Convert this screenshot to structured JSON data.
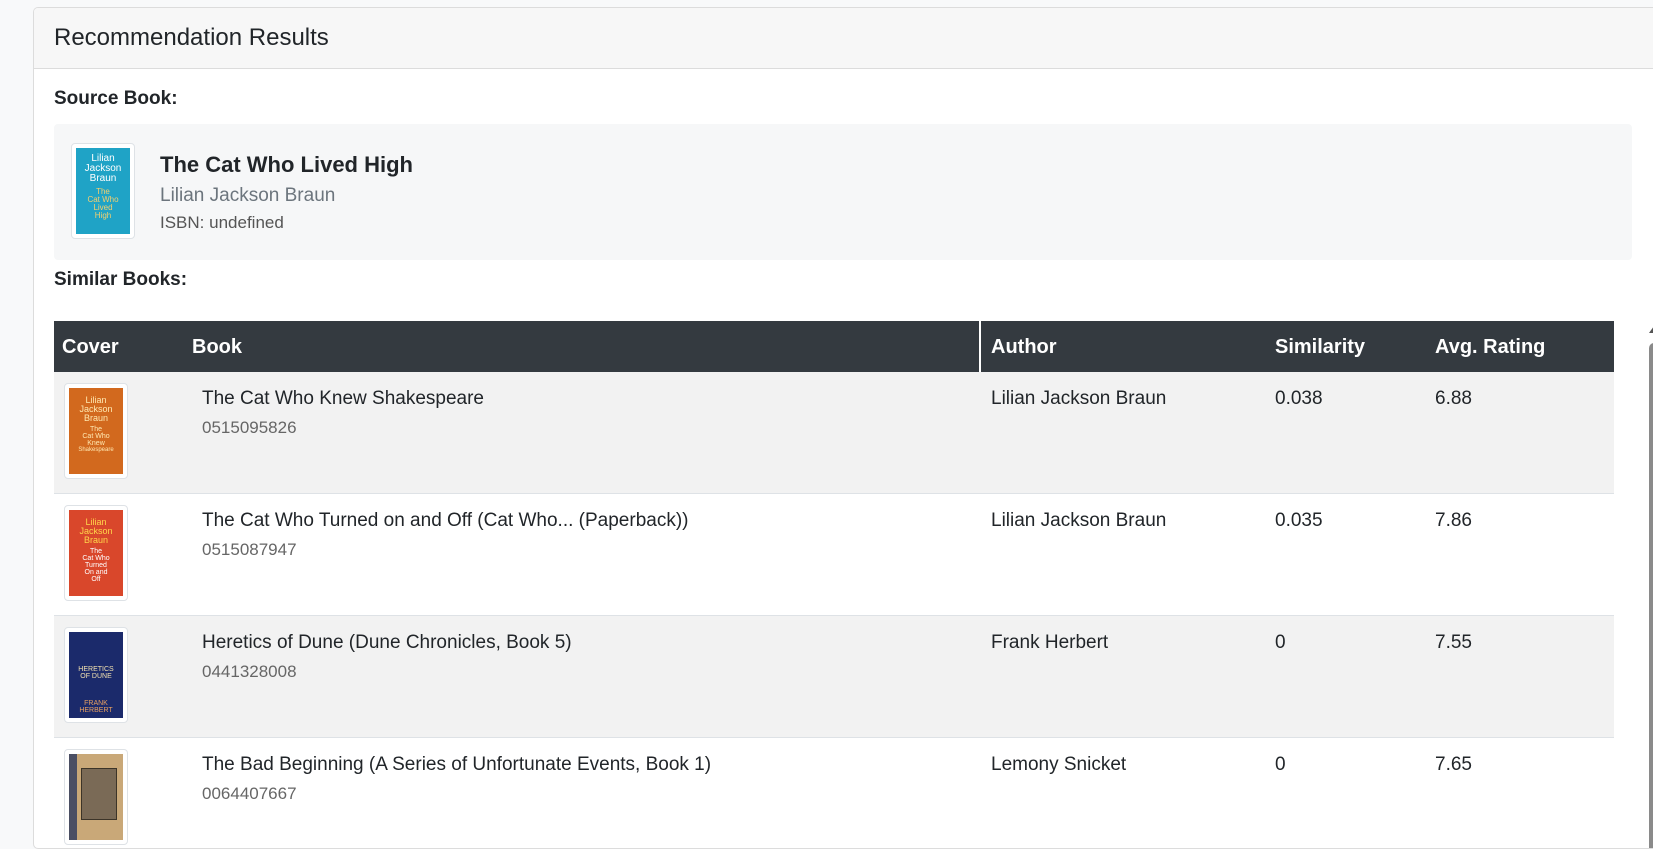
{
  "header": {
    "title": "Recommendation Results"
  },
  "source": {
    "label": "Source Book:",
    "title": "The Cat Who Lived High",
    "author": "Lilian Jackson Braun",
    "isbn": "ISBN: undefined",
    "cover_lines": [
      "Lilian",
      "Jackson",
      "Braun",
      "The",
      "Cat Who",
      "Lived",
      "High"
    ]
  },
  "similar": {
    "label": "Similar Books:",
    "columns": {
      "cover": "Cover",
      "book": "Book",
      "author": "Author",
      "similarity": "Similarity",
      "rating": "Avg. Rating"
    },
    "rows": [
      {
        "title": "The Cat Who Knew Shakespeare",
        "isbn": "0515095826",
        "author": "Lilian Jackson Braun",
        "similarity": "0.038",
        "rating": "6.88",
        "cover_lines": [
          "Lilian",
          "Jackson",
          "Braun",
          "The",
          "Cat Who",
          "Knew",
          "Shakespeare"
        ],
        "cover_color": "#d2691e"
      },
      {
        "title": "The Cat Who Turned on and Off (Cat Who... (Paperback))",
        "isbn": "0515087947",
        "author": "Lilian Jackson Braun",
        "similarity": "0.035",
        "rating": "7.86",
        "cover_lines": [
          "Lilian",
          "Jackson",
          "Braun",
          "The",
          "Cat Who",
          "Turned",
          "On and",
          "Off"
        ],
        "cover_color": "#d9472b"
      },
      {
        "title": "Heretics of Dune (Dune Chronicles, Book 5)",
        "isbn": "0441328008",
        "author": "Frank Herbert",
        "similarity": "0",
        "rating": "7.55",
        "cover_lines": [
          "HERETICS",
          "OF DUNE",
          "FRANK",
          "HERBERT"
        ],
        "cover_color": "#1b2a6b"
      },
      {
        "title": "The Bad Beginning (A Series of Unfortunate Events, Book 1)",
        "isbn": "0064407667",
        "author": "Lemony Snicket",
        "similarity": "0",
        "rating": "7.65",
        "cover_lines": [],
        "cover_color": "#c9a878"
      }
    ]
  }
}
